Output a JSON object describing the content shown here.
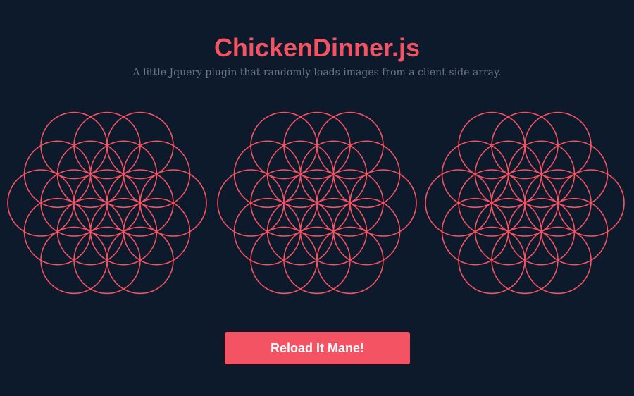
{
  "header": {
    "title": "ChickenDinner.js",
    "subtitle": "A little Jquery plugin that randomly loads images from a client-side array."
  },
  "images": [
    {
      "icon": "flower-of-life-icon"
    },
    {
      "icon": "flower-of-life-icon"
    },
    {
      "icon": "flower-of-life-icon"
    }
  ],
  "button": {
    "label": "Reload It Mane!"
  },
  "colors": {
    "background": "#0c1a2b",
    "accent": "#f35362",
    "subtitle": "#6b7785"
  }
}
